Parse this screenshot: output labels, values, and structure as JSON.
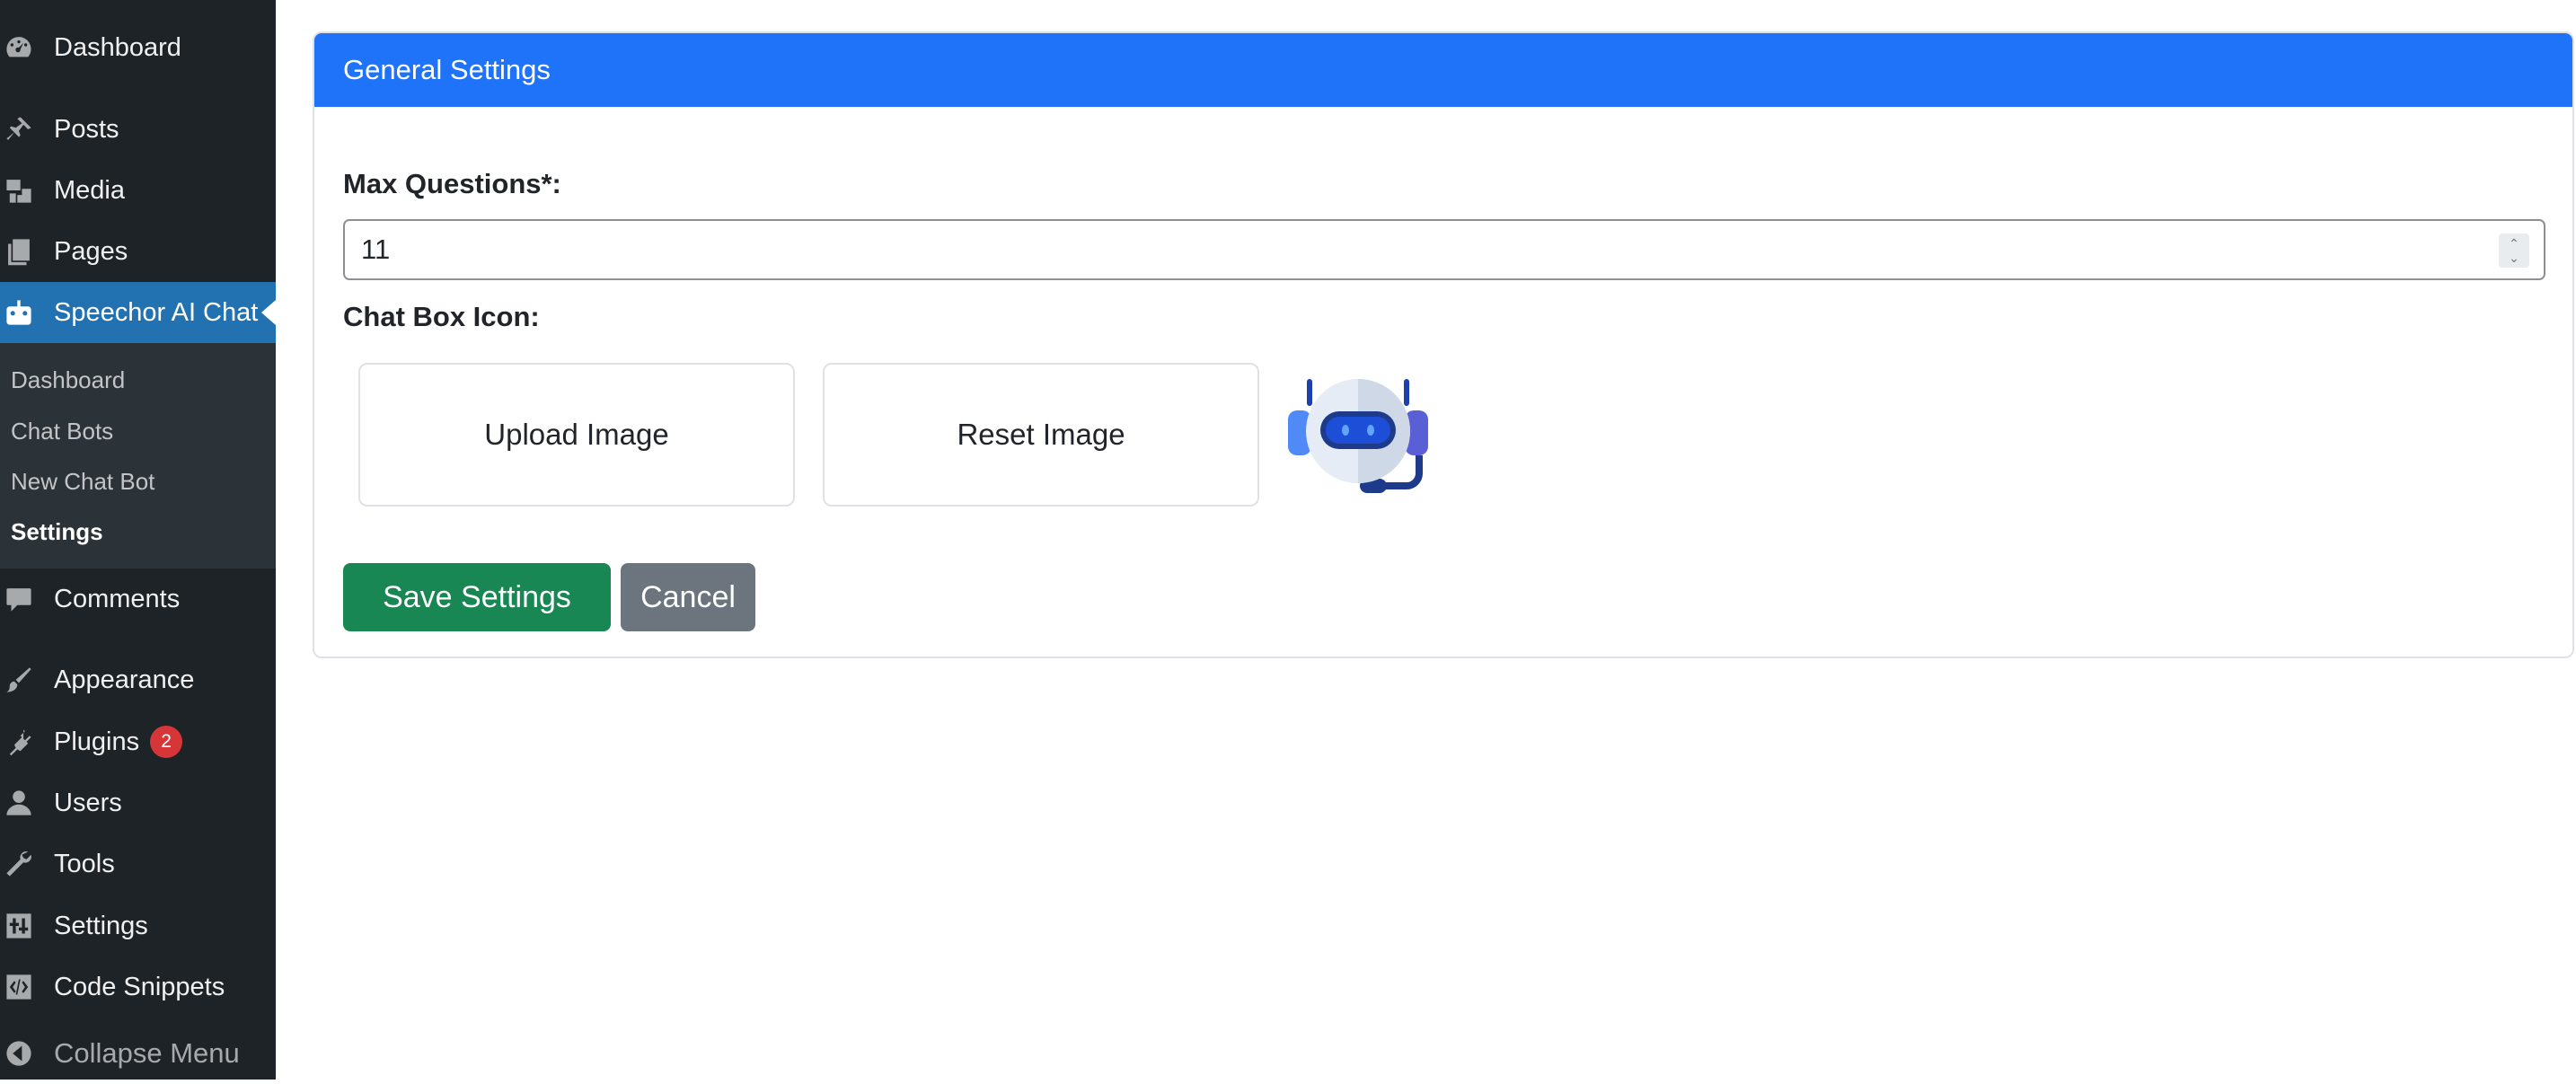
{
  "sidebar": {
    "items": [
      {
        "label": "Dashboard",
        "icon": "dashboard-icon"
      },
      {
        "label": "Posts",
        "icon": "pin-icon"
      },
      {
        "label": "Media",
        "icon": "media-icon"
      },
      {
        "label": "Pages",
        "icon": "pages-icon"
      },
      {
        "label": "Speechor AI Chat",
        "icon": "robot-icon"
      },
      {
        "label": "Comments",
        "icon": "comment-icon"
      },
      {
        "label": "Appearance",
        "icon": "brush-icon"
      },
      {
        "label": "Plugins",
        "icon": "plug-icon",
        "badge": "2"
      },
      {
        "label": "Users",
        "icon": "user-icon"
      },
      {
        "label": "Tools",
        "icon": "wrench-icon"
      },
      {
        "label": "Settings",
        "icon": "sliders-icon"
      },
      {
        "label": "Code Snippets",
        "icon": "code-icon"
      }
    ],
    "submenu": [
      "Dashboard",
      "Chat Bots",
      "New Chat Bot",
      "Settings"
    ],
    "collapse_label": "Collapse Menu"
  },
  "card": {
    "title": "General Settings",
    "max_questions_label": "Max Questions*:",
    "max_questions_value": "11",
    "chat_box_icon_label": "Chat Box Icon:",
    "upload_label": "Upload Image",
    "reset_label": "Reset Image",
    "save_label": "Save Settings",
    "cancel_label": "Cancel"
  },
  "colors": {
    "sidebar_bg": "#1d2327",
    "active_menu": "#2271b1",
    "header_blue": "#1e73f8",
    "save_green": "#198754",
    "cancel_gray": "#6c757d",
    "badge_red": "#d63638"
  }
}
